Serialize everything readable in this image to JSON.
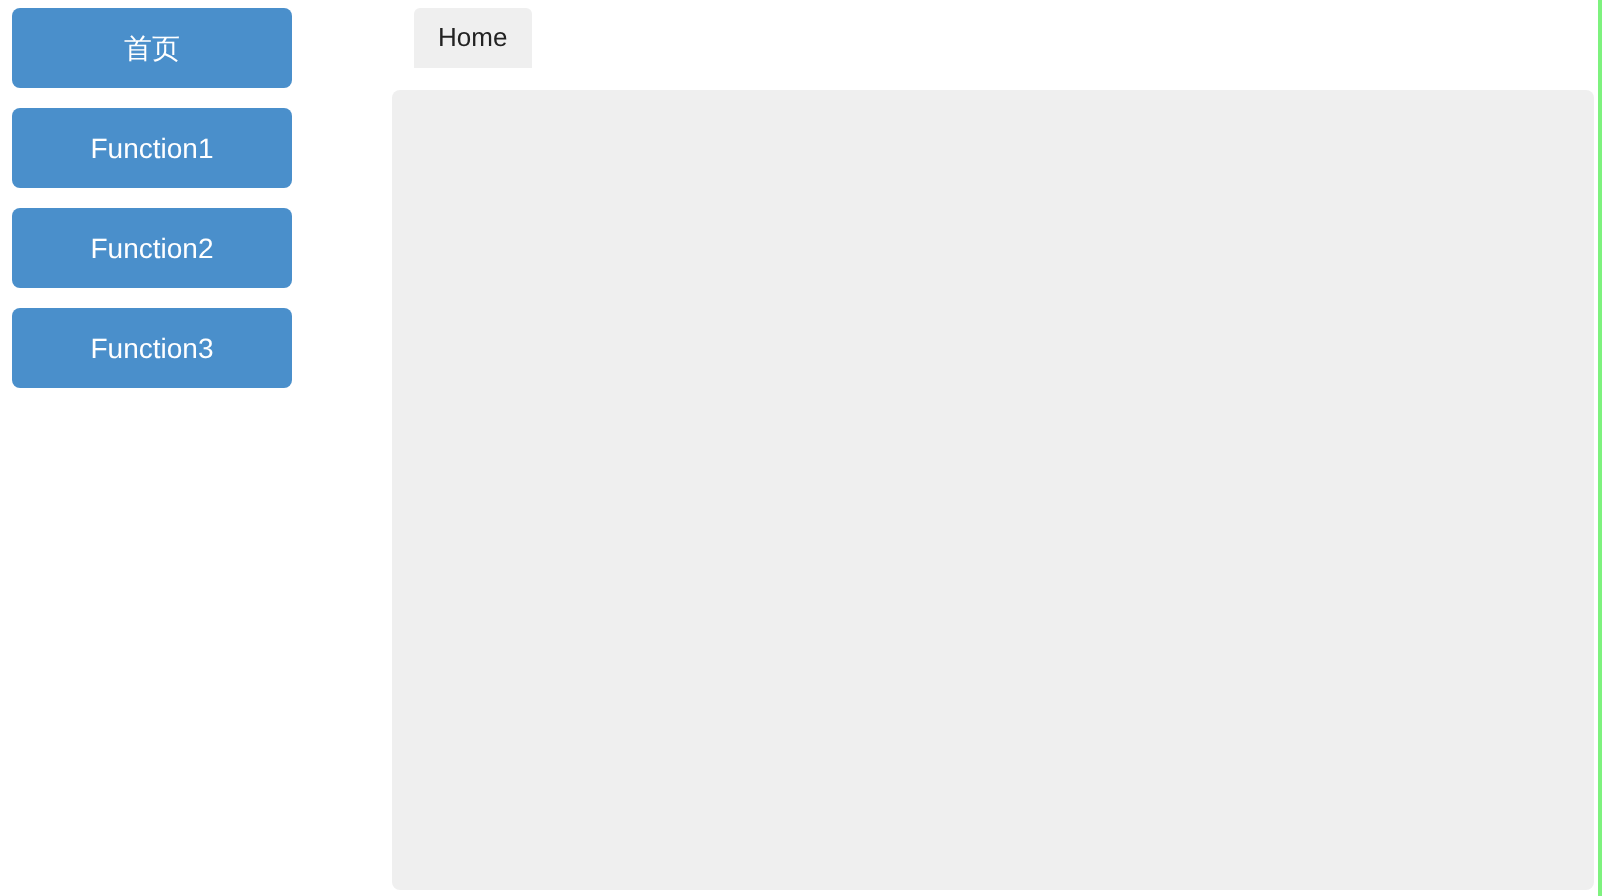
{
  "sidebar": {
    "items": [
      {
        "label": "首页"
      },
      {
        "label": "Function1"
      },
      {
        "label": "Function2"
      },
      {
        "label": "Function3"
      }
    ]
  },
  "tabs": [
    {
      "label": "Home",
      "selected": true
    }
  ]
}
